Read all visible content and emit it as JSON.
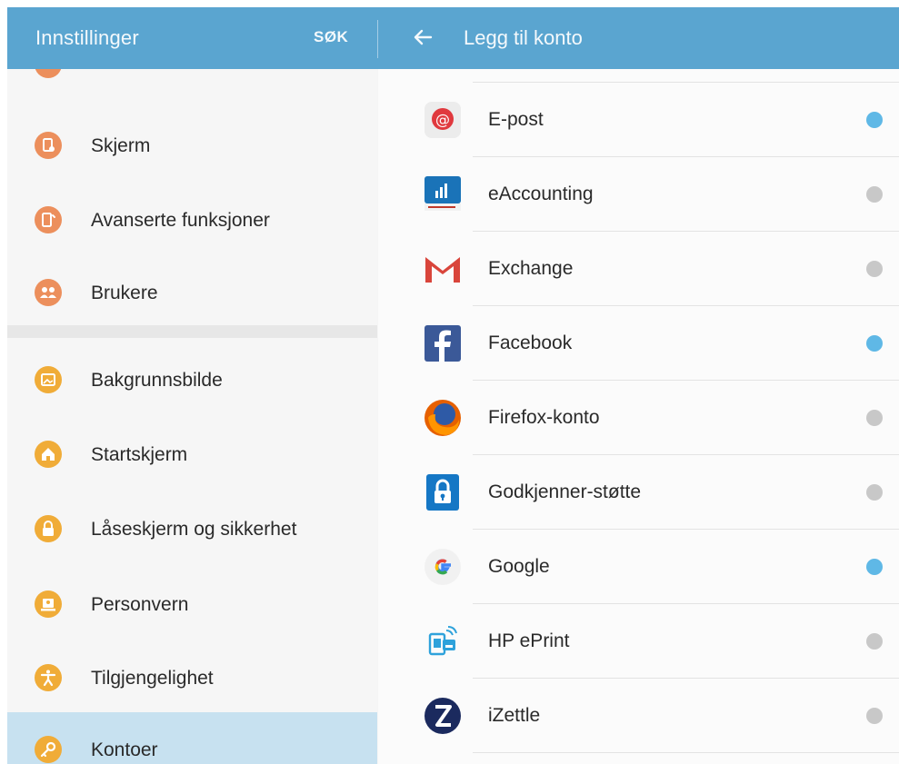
{
  "colors": {
    "header_bg": "#5aa5d0",
    "active_item_bg": "#c7e1f0",
    "dot_active": "#5fb8e6",
    "dot_inactive": "#c8c8c8",
    "icon_orange": "#ec8f5c",
    "icon_amber": "#f0ac38"
  },
  "header": {
    "left_title": "Innstillinger",
    "search_label": "SØK",
    "back_icon": "arrow-left-icon",
    "right_title": "Legg til konto"
  },
  "sidebar": {
    "items": [
      {
        "label": "Skjerm",
        "icon": "display-icon",
        "active": false
      },
      {
        "label": "Avanserte funksjoner",
        "icon": "advanced-features-icon",
        "active": false
      },
      {
        "label": "Brukere",
        "icon": "users-icon",
        "active": false
      },
      {
        "label": "Bakgrunnsbilde",
        "icon": "wallpaper-icon",
        "active": false
      },
      {
        "label": "Startskjerm",
        "icon": "home-icon",
        "active": false
      },
      {
        "label": "Låseskjerm og sikkerhet",
        "icon": "lock-icon",
        "active": false
      },
      {
        "label": "Personvern",
        "icon": "privacy-icon",
        "active": false
      },
      {
        "label": "Tilgjengelighet",
        "icon": "accessibility-icon",
        "active": false
      },
      {
        "label": "Kontoer",
        "icon": "key-icon",
        "active": true
      }
    ]
  },
  "accounts": {
    "items": [
      {
        "label": "E-post",
        "icon": "email-icon",
        "status": "active"
      },
      {
        "label": "eAccounting",
        "icon": "eaccounting-icon",
        "status": "inactive"
      },
      {
        "label": "Exchange",
        "icon": "gmail-exchange-icon",
        "status": "inactive"
      },
      {
        "label": "Facebook",
        "icon": "facebook-icon",
        "status": "active"
      },
      {
        "label": "Firefox-konto",
        "icon": "firefox-icon",
        "status": "inactive"
      },
      {
        "label": "Godkjenner-støtte",
        "icon": "authenticator-icon",
        "status": "inactive"
      },
      {
        "label": "Google",
        "icon": "google-icon",
        "status": "active"
      },
      {
        "label": "HP ePrint",
        "icon": "hp-eprint-icon",
        "status": "inactive"
      },
      {
        "label": "iZettle",
        "icon": "izettle-icon",
        "status": "inactive"
      }
    ]
  }
}
